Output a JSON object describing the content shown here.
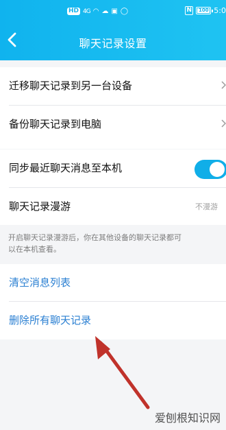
{
  "status_bar": {
    "left_badge": "HD",
    "signal_text": "4G",
    "battery": "100",
    "time": "5:0"
  },
  "header": {
    "title": "聊天记录设置"
  },
  "settings": {
    "migrate": "迁移聊天记录到另一台设备",
    "backup": "备份聊天记录到电脑",
    "sync_recent": "同步最近聊天消息至本机",
    "roaming": "聊天记录漫游",
    "roaming_value": "不漫游",
    "roaming_desc": "开启聊天记录漫游后，你在其他设备的聊天记录都可\n以在本机查看。",
    "clear_list": "清空消息列表",
    "delete_all": "删除所有聊天记录"
  },
  "toggle_state": "on",
  "watermark": "爱刨根知识网",
  "colors": {
    "header": "#10b3ee",
    "accent": "#10aee8",
    "action": "#2a7fd2",
    "annotation_arrow": "#c0322b"
  },
  "icons": [
    "back-arrow-icon",
    "chevron-right-icon",
    "wifi-icon",
    "battery-icon",
    "nfc-icon",
    "red-arrow-icon"
  ]
}
